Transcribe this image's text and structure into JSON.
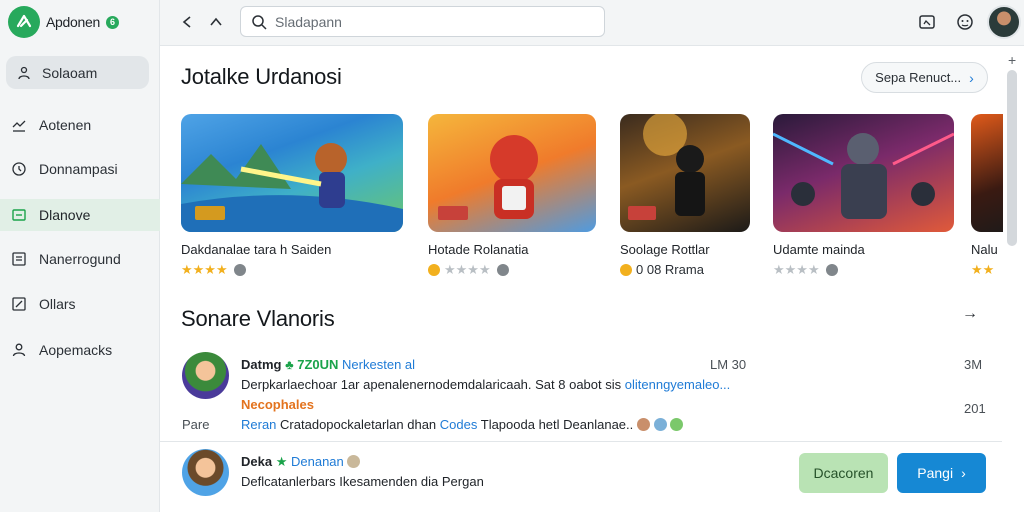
{
  "brand": {
    "name": "Apdonen",
    "badge": "6"
  },
  "sidebar": {
    "search_label": "Solaoam",
    "items": [
      {
        "label": "Aotenen",
        "icon": "swap-icon"
      },
      {
        "label": "Donnampasi",
        "icon": "clock-icon"
      },
      {
        "label": "Dlanove",
        "icon": "window-icon",
        "active": true
      },
      {
        "label": "Nanerrogund",
        "icon": "list-icon"
      },
      {
        "label": "Ollars",
        "icon": "edit-icon"
      },
      {
        "label": "Aopemacks",
        "icon": "user-icon"
      }
    ]
  },
  "topbar": {
    "search_placeholder": "Sladapann"
  },
  "featured": {
    "title": "Jotalke Urdanosi",
    "see_all_label": "Sepa Renuct...",
    "games": [
      {
        "title": "Dakdanalae tara h Saiden",
        "rating_text": "",
        "stars": 4,
        "theme": "hero"
      },
      {
        "title": "Hotade Rolanatia",
        "rating_text": "",
        "stars": 5,
        "theme": "devil"
      },
      {
        "title": "Soolage Rottlar",
        "rating_text": "0 08 Rrama",
        "stars": 0,
        "theme": "dark"
      },
      {
        "title": "Udamte mainda",
        "rating_text": "",
        "stars": 4,
        "theme": "robot"
      },
      {
        "title": "Nalu",
        "rating_text": "",
        "stars": 2,
        "theme": "red"
      }
    ]
  },
  "updates": {
    "title": "Sonare Vlanoris",
    "items": [
      {
        "name": "Datmg",
        "tag": "7Z0UN",
        "link": "Nerkesten al",
        "time": "LM 30",
        "right_top": "3M",
        "desc": "Derpkarlaechoar 1ar apenalenernodemdalaricaah. Sat 8 oabot sis",
        "highlight": "olitenngyemaleo...",
        "sub": "Necophales",
        "right_bottom": "201",
        "footer_left": "Pare",
        "footer_link": "Reran",
        "footer_text": "Cratadopockaletarlan dhan",
        "footer_blue": "Codes",
        "footer_end": "Tlapooda hetl Deanlanae.."
      },
      {
        "name": "Deka",
        "link": "Denanan",
        "desc": "Deflcatanlerbars Ikesamenden dia Pergan",
        "button_secondary": "Dcacoren",
        "button_primary": "Pangi"
      }
    ]
  }
}
